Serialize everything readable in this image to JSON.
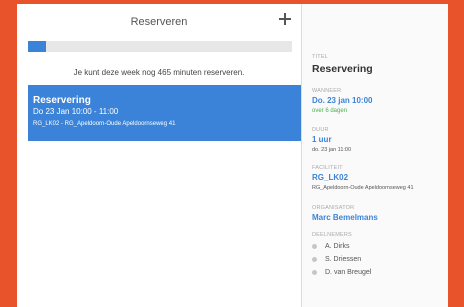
{
  "left": {
    "title": "Reserveren",
    "progress_fraction": 0.07,
    "quota_text": "Je kunt deze week nog 465 minuten reserveren.",
    "reservation": {
      "title": "Reservering",
      "time": "Do 23 Jan 10:00 - 11:00",
      "location": "RG_LK02 - RG_Apeldoorn-Oude Apeldoornseweg 41"
    }
  },
  "details": {
    "title_label": "TITEL",
    "title_value": "Reservering",
    "when_label": "WANNEER",
    "when_value": "Do. 23 jan 10:00",
    "when_relative": "over 6 dagen",
    "duration_label": "DUUR",
    "duration_value": "1 uur",
    "duration_sub": "do. 23 jan 11:00",
    "facility_label": "FACILITEIT",
    "facility_value": "RG_LK02",
    "facility_sub": "RG_Apeldoorn-Oude Apeldoornseweg 41",
    "organizer_label": "ORGANISATOR",
    "organizer_value": "Marc Bemelmans",
    "participants_label": "DEELNEMERS",
    "participants": [
      "A. Dirks",
      "S. Driessen",
      "D. van Breugel"
    ]
  },
  "colors": {
    "accent": "#3b83d9",
    "frame": "#e8532c",
    "success": "#4caf50"
  },
  "icons": {
    "add": "plus-icon"
  }
}
